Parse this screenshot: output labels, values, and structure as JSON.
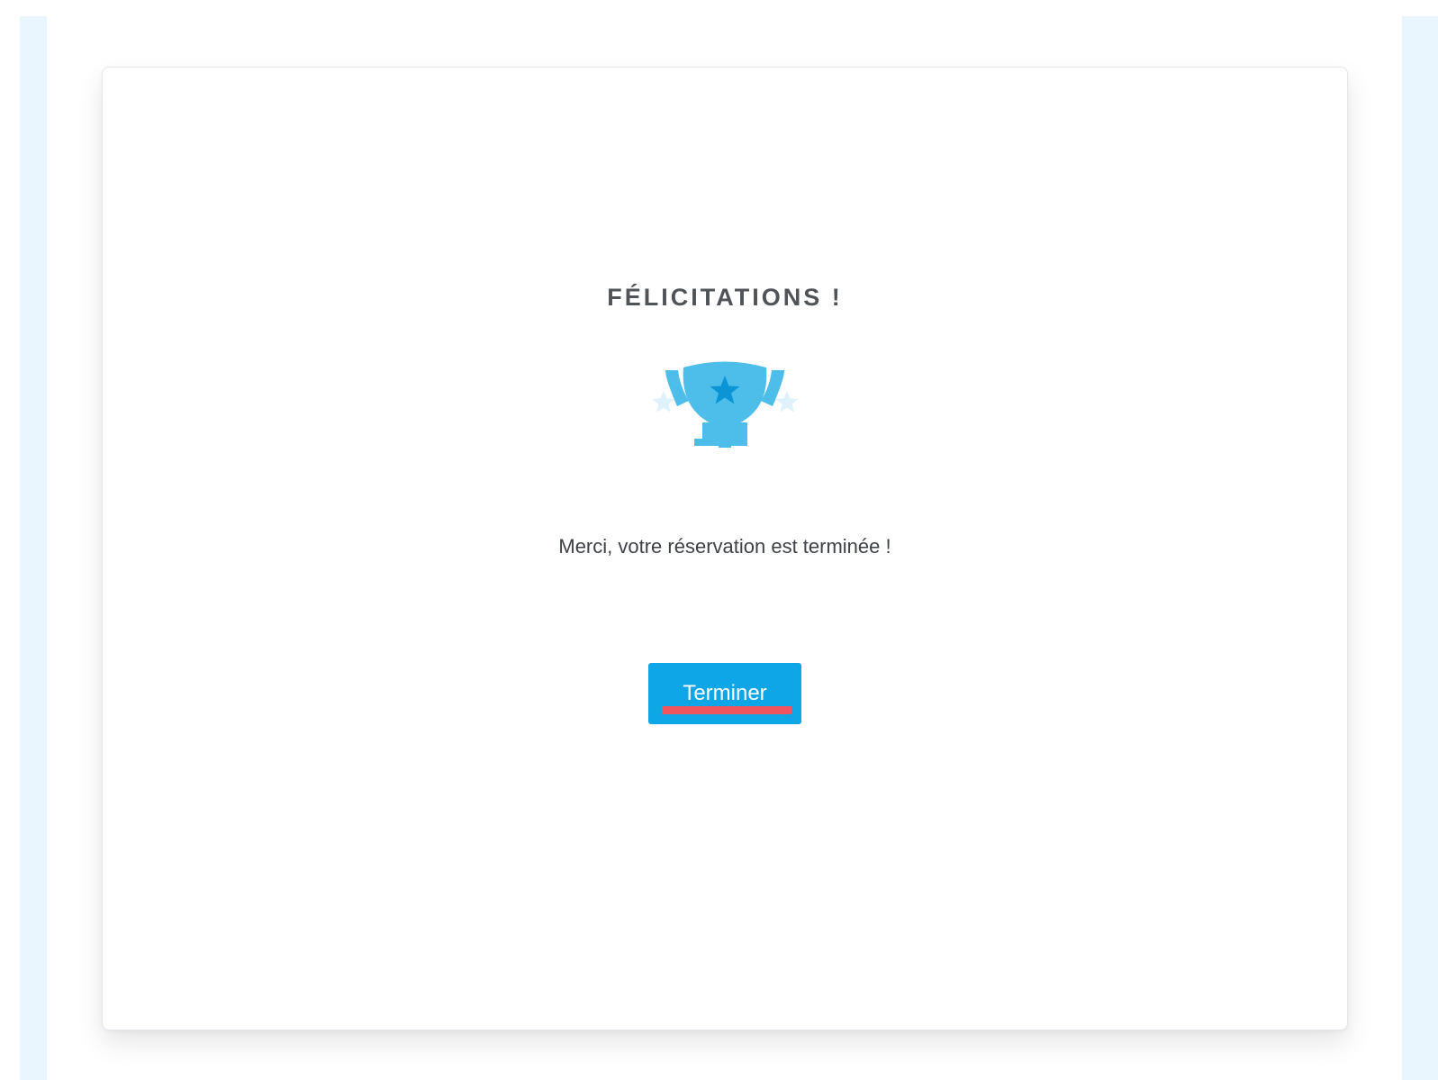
{
  "confirmation": {
    "title": "FÉLICITATIONS !",
    "trophy_icon": "trophy-icon",
    "message": "Merci, votre réservation est terminée !",
    "finish_button_label": "Terminer"
  },
  "colors": {
    "accent": "#0ea6e7",
    "trophy": "#4dbdea",
    "trophy_star": "#0b95d6",
    "sparkle": "#dff2fc",
    "highlight": "#f1545c",
    "side_stripe": "#eaf6fe"
  }
}
